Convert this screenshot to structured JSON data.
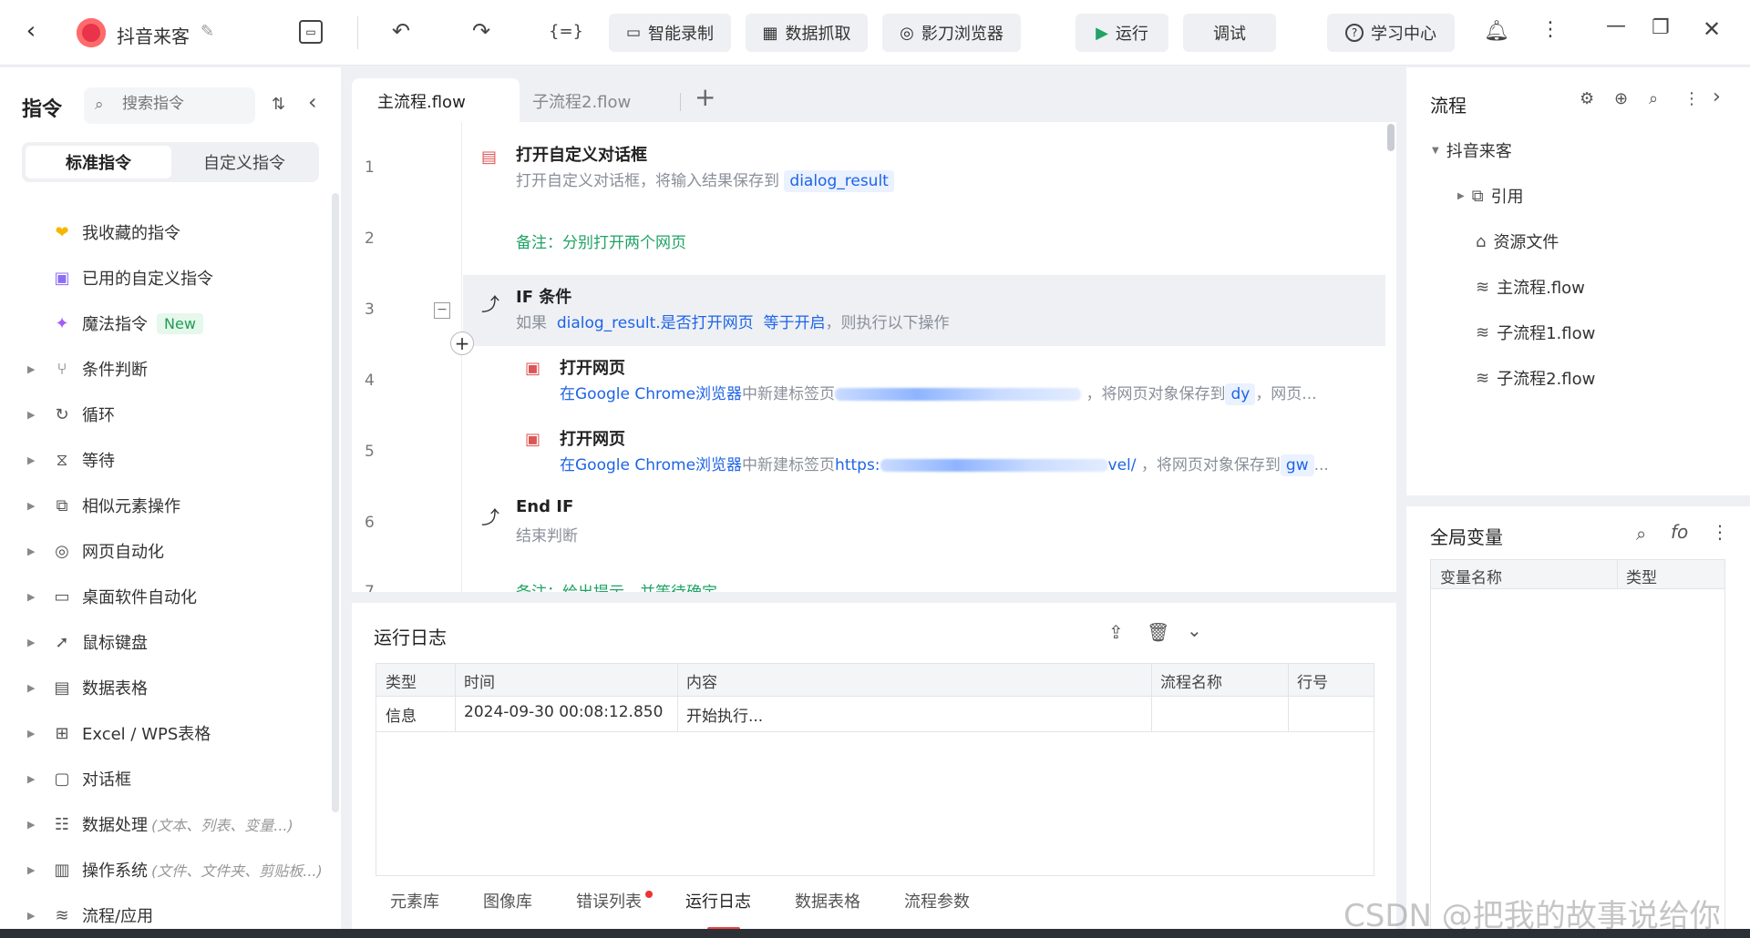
{
  "app": {
    "title": "抖音来客"
  },
  "toolbar": {
    "record": "智能录制",
    "scrape": "数据抓取",
    "browser": "影刀浏览器",
    "run": "运行",
    "debug": "调试",
    "learn": "学习中心"
  },
  "left": {
    "title": "指令",
    "search_placeholder": "搜索指令",
    "tabs": [
      "标准指令",
      "自定义指令"
    ],
    "items": [
      {
        "label": "我收藏的指令",
        "icon": "heart-icon"
      },
      {
        "label": "已用的自定义指令",
        "icon": "calendar-icon"
      },
      {
        "label": "魔法指令",
        "icon": "sparkle-icon",
        "badge": "New"
      },
      {
        "label": "条件判断",
        "icon": "branch-icon"
      },
      {
        "label": "循环",
        "icon": "loop-icon"
      },
      {
        "label": "等待",
        "icon": "hourglass-icon"
      },
      {
        "label": "相似元素操作",
        "icon": "copy-icon"
      },
      {
        "label": "网页自动化",
        "icon": "chrome-icon"
      },
      {
        "label": "桌面软件自动化",
        "icon": "monitor-icon"
      },
      {
        "label": "鼠标键盘",
        "icon": "cursor-icon"
      },
      {
        "label": "数据表格",
        "icon": "document-icon"
      },
      {
        "label": "Excel / WPS表格",
        "icon": "excel-icon"
      },
      {
        "label": "对话框",
        "icon": "dialog-icon"
      },
      {
        "label": "数据处理",
        "icon": "data-icon",
        "hint": "(文本、列表、变量...)"
      },
      {
        "label": "操作系统",
        "icon": "system-icon",
        "hint": "(文件、文件夹、剪贴板...)"
      },
      {
        "label": "流程/应用",
        "icon": "layers-icon"
      }
    ]
  },
  "editor": {
    "tabs": [
      "主流程.flow",
      "子流程2.flow"
    ],
    "lines": [
      "1",
      "2",
      "3",
      "4",
      "5",
      "6",
      "7"
    ],
    "step1": {
      "title": "打开自定义对话框",
      "desc": "打开自定义对话框，将输入结果保存到",
      "var": "dialog_result"
    },
    "step2": {
      "note": "备注：分别打开两个网页"
    },
    "step3": {
      "title": "IF 条件",
      "prefix": "如果",
      "cond": "dialog_result.是否打开网页",
      "op": "等于开启",
      "suffix": "，则执行以下操作"
    },
    "step4": {
      "title": "打开网页",
      "desc_a": "在",
      "browser": "Google Chrome浏览器",
      "desc_b": "中新建标签页",
      "url_part": "https://...",
      "save": "，将网页对象保存到",
      "var": "dy",
      "tail": "，网页..."
    },
    "step5": {
      "title": "打开网页",
      "desc_a": "在",
      "browser": "Google Chrome浏览器",
      "desc_b": "中新建标签页",
      "url_part": "https:",
      "url_tail": "vel/",
      "save": "，将网页对象保存到",
      "var": "gw",
      "tail": "..."
    },
    "step6": {
      "title": "End IF",
      "desc": "结束判断"
    },
    "step7": {
      "note": "备注：给出提示，并等待确定"
    }
  },
  "log": {
    "title": "运行日志",
    "headers": [
      "类型",
      "时间",
      "内容",
      "流程名称",
      "行号"
    ],
    "rows": [
      {
        "type": "信息",
        "time": "2024-09-30 00:08:12.850",
        "content": "开始执行...",
        "flow": "",
        "line": ""
      }
    ]
  },
  "bottom_tabs": [
    "元素库",
    "图像库",
    "错误列表",
    "运行日志",
    "数据表格",
    "流程参数"
  ],
  "flow_panel": {
    "title": "流程",
    "root": "抖音来客",
    "items": [
      "引用",
      "资源文件",
      "主流程.flow",
      "子流程1.flow",
      "子流程2.flow"
    ]
  },
  "globals": {
    "title": "全局变量",
    "headers": [
      "变量名称",
      "类型"
    ]
  },
  "watermark": "CSDN @把我的故事说给你"
}
